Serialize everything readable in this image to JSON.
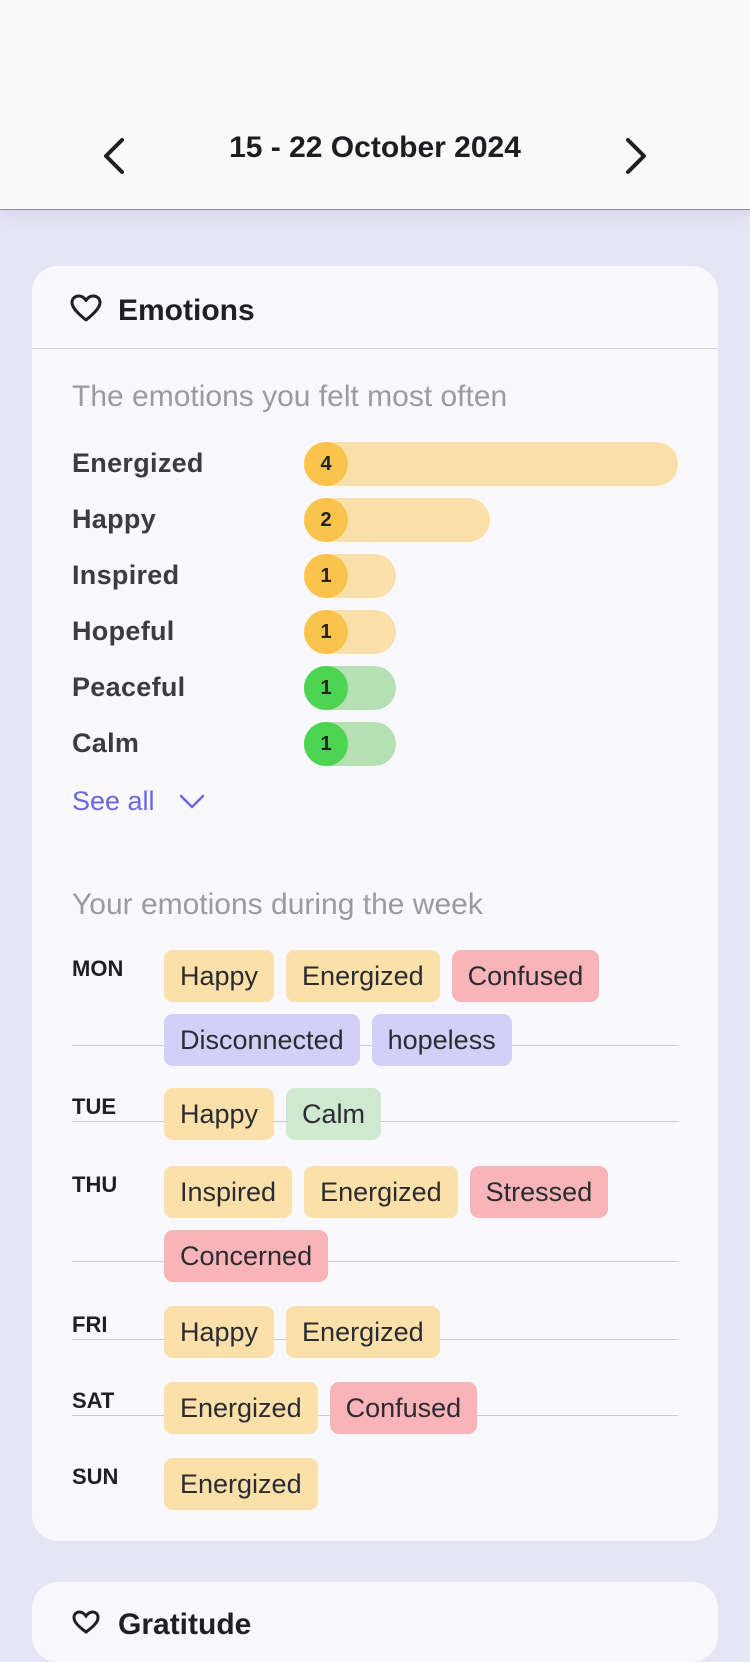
{
  "header": {
    "date_range": "15 - 22 October 2024"
  },
  "emotions_card": {
    "title": "Emotions",
    "most_often_title": "The emotions you felt most often",
    "top_emotions": [
      {
        "label": "Energized",
        "count": "4",
        "color": "#fbc34b"
      },
      {
        "label": "Happy",
        "count": "2",
        "color": "#fbc34b"
      },
      {
        "label": "Inspired",
        "count": "1",
        "color": "#fbc34b"
      },
      {
        "label": "Hopeful",
        "count": "1",
        "color": "#fbc34b"
      },
      {
        "label": "Peaceful",
        "count": "1",
        "color": "#4cd450"
      },
      {
        "label": "Calm",
        "count": "1",
        "color": "#4cd450"
      }
    ],
    "see_all": "See all",
    "week_title": "Your emotions during the week",
    "week": [
      {
        "day": "MON",
        "emotions": [
          "Happy",
          "Energized",
          "Confused",
          "Disconnected",
          "hopeless"
        ]
      },
      {
        "day": "TUE",
        "emotions": [
          "Happy",
          "Calm"
        ]
      },
      {
        "day": "THU",
        "emotions": [
          "Inspired",
          "Energized",
          "Stressed",
          "Concerned"
        ]
      },
      {
        "day": "FRI",
        "emotions": [
          "Happy",
          "Energized"
        ]
      },
      {
        "day": "SAT",
        "emotions": [
          "Energized",
          "Confused"
        ]
      },
      {
        "day": "SUN",
        "emotions": [
          "Energized"
        ]
      }
    ]
  },
  "next_card": {
    "title": "Gratitude"
  },
  "colors": {
    "positive": "#fbe0a9",
    "calm": "#cfe8d0",
    "negative": "#f9b4b9",
    "low": "#d2d0f8",
    "accent": "#6b66e0"
  }
}
